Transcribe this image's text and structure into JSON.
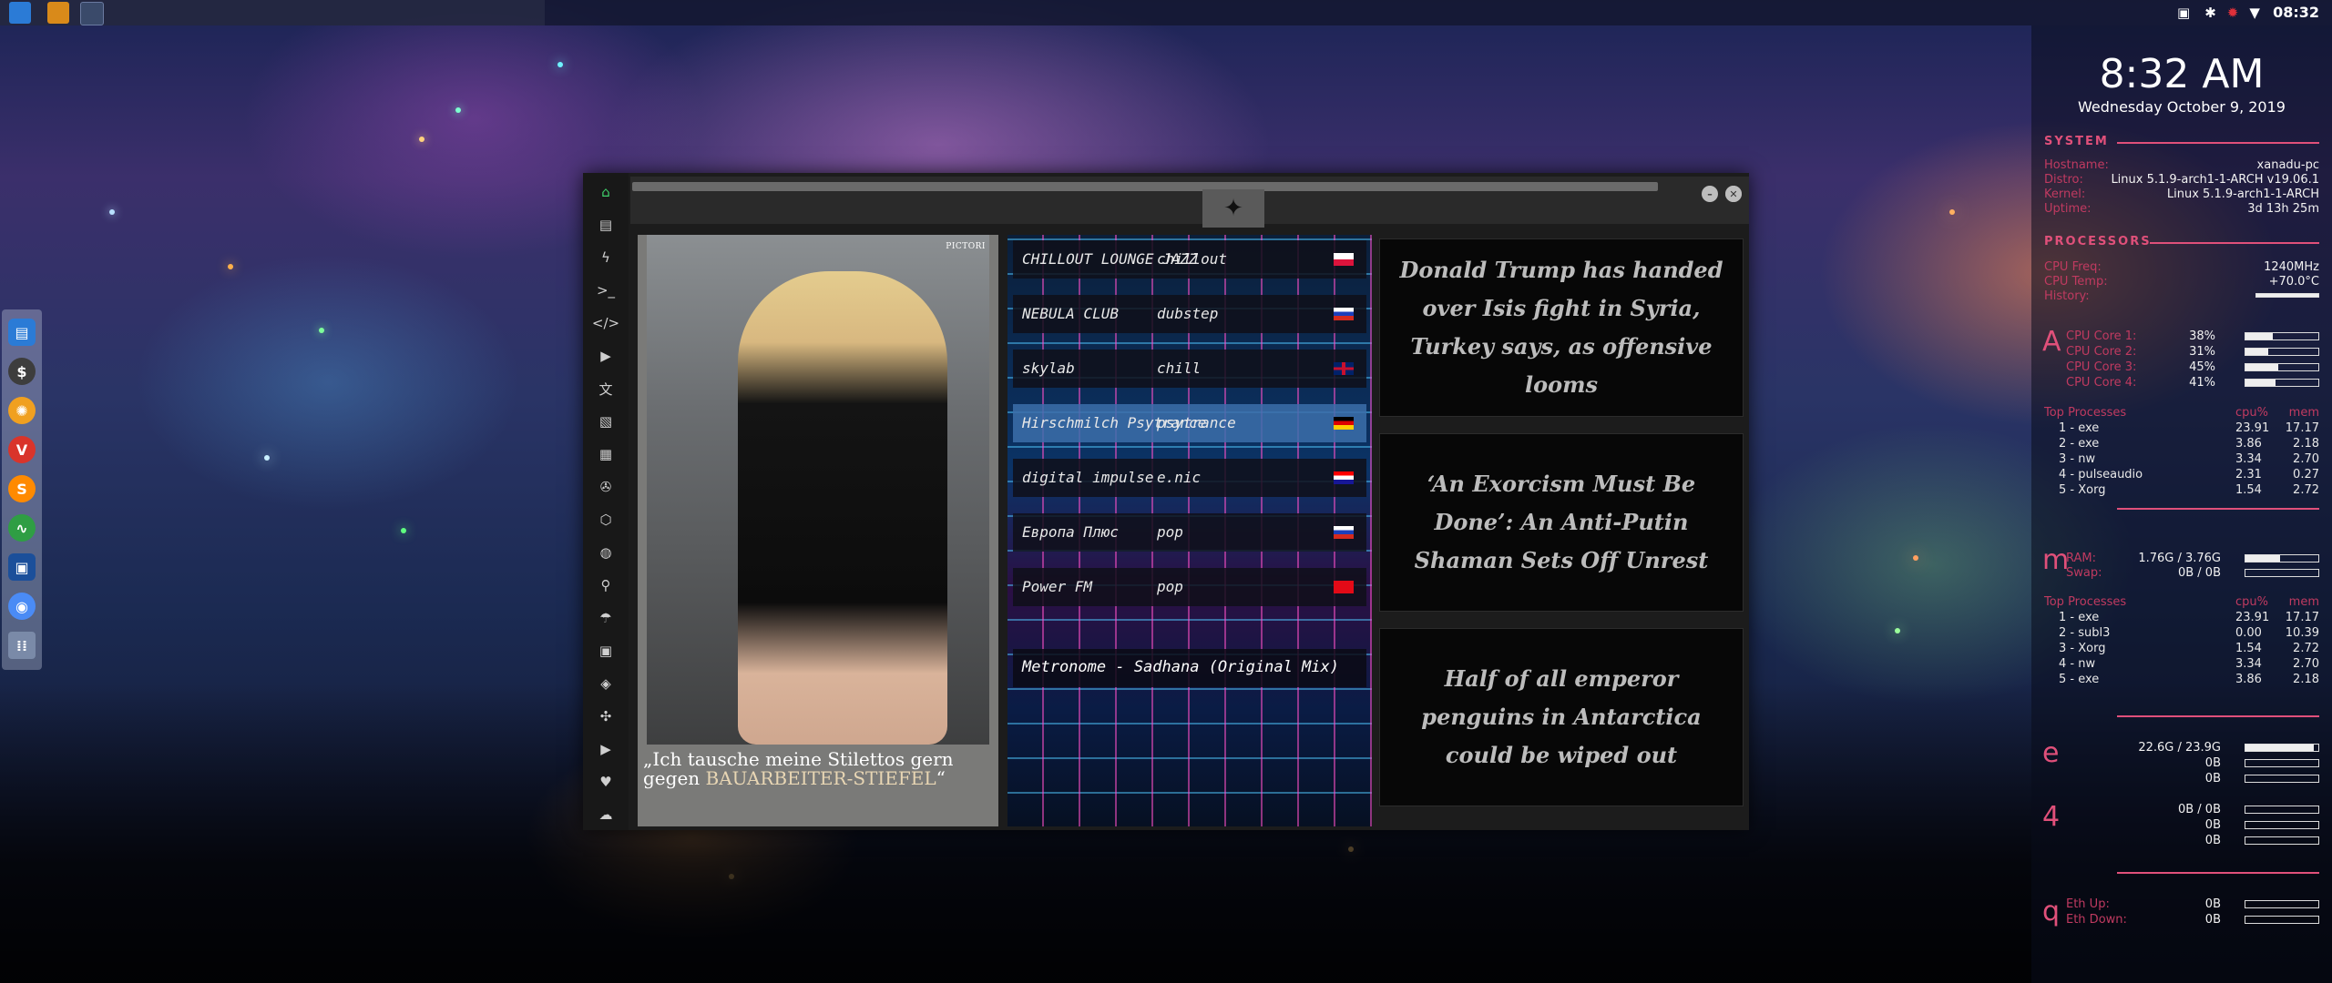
{
  "topbar": {
    "clock": "08:32",
    "tray_icons": [
      "image-icon",
      "bluetooth-icon",
      "bug-icon",
      "wifi-icon"
    ]
  },
  "dock": {
    "apps": [
      {
        "icon": "files-icon",
        "color": "#2b7bd6"
      },
      {
        "icon": "terminal-icon",
        "color": "#3d3d3d"
      },
      {
        "icon": "gear-app-icon",
        "color": "#f0a020"
      },
      {
        "icon": "vivaldi-icon",
        "color": "#d9342b"
      },
      {
        "icon": "sublime-icon",
        "color": "#ff8a00"
      },
      {
        "icon": "system-monitor-icon",
        "color": "#2f9e44"
      },
      {
        "icon": "virtualbox-icon",
        "color": "#1b4f9a"
      },
      {
        "icon": "chrome-icon",
        "color": "#4a8bf5"
      },
      {
        "icon": "app-grid-icon",
        "color": "#7a8aa8"
      }
    ]
  },
  "app": {
    "sidebar_icons": [
      "home-icon",
      "document-icon",
      "bolt-icon",
      "terminal-icon",
      "code-icon",
      "play-icon",
      "translate-icon",
      "image-icon",
      "gallery-icon",
      "aperture-icon",
      "hexagon-icon",
      "globe-icon",
      "search-icon",
      "umbrella-icon",
      "contacts-icon",
      "dev-icon",
      "expand-icon",
      "youtube-icon",
      "heart-icon",
      "cloud-icon"
    ],
    "title_emblem": "rebel-alliance-icon",
    "magazine": {
      "header": "PICTORI",
      "quote_line1": "„Ich tausche meine Stilettos gern",
      "quote_prefix": "gegen ",
      "quote_accent": "BAUARBEITER-STIEFEL",
      "quote_suffix": "“"
    },
    "stations": [
      {
        "name": "CHILLOUT LOUNGE JAZZ",
        "genre": "chillout",
        "flag": "poland",
        "active": false
      },
      {
        "name": "NEBULA CLUB",
        "genre": "dubstep",
        "flag": "russia",
        "active": false
      },
      {
        "name": "skylab",
        "genre": "chill",
        "flag": "uk",
        "active": false
      },
      {
        "name": "Hirschmilch Psytrance",
        "genre": "psytrance",
        "flag": "germany",
        "active": true
      },
      {
        "name": "digital impulse",
        "genre": "e.nic",
        "flag": "croatia",
        "active": false
      },
      {
        "name": "Европа Плюс",
        "genre": "pop",
        "flag": "russia",
        "active": false
      },
      {
        "name": "Power FM",
        "genre": "pop",
        "flag": "turkey",
        "active": false
      }
    ],
    "now_playing": "Metronome - Sadhana (Original Mix)",
    "news": [
      "Donald Trump has handed over Isis fight in Syria, Turkey says, as offensive looms",
      "‘An Exorcism Must Be Done’: An Anti-Putin Shaman Sets Off Unrest",
      "Half of all emperor penguins in Antarctica could be wiped out"
    ]
  },
  "conky": {
    "time": "8:32 AM",
    "date": "Wednesday October  9, 2019",
    "system": {
      "title": "SYSTEM",
      "rows": [
        {
          "k": "Hostname:",
          "v": "xanadu-pc"
        },
        {
          "k": "Distro:",
          "v": "Linux 5.1.9-arch1-1-ARCH v19.06.1"
        },
        {
          "k": "Kernel:",
          "v": "Linux 5.1.9-arch1-1-ARCH"
        },
        {
          "k": "Uptime:",
          "v": "3d 13h 25m"
        }
      ]
    },
    "processors": {
      "title": "PROCESSORS",
      "freq_label": "CPU Freq:",
      "freq": "1240MHz",
      "temp_label": "CPU Temp:",
      "temp": "+70.0°C",
      "history_label": "History:",
      "letter": "A",
      "cores": [
        {
          "k": "CPU Core 1:",
          "v": "38%",
          "level": 0.38
        },
        {
          "k": "CPU Core 2:",
          "v": "31%",
          "level": 0.31
        },
        {
          "k": "CPU Core 3:",
          "v": "45%",
          "level": 0.45
        },
        {
          "k": "CPU Core 4:",
          "v": "41%",
          "level": 0.41
        }
      ],
      "top_title": "Top Processes",
      "col_cpu": "cpu%",
      "col_mem": "mem",
      "procs": [
        {
          "n": "1 - exe",
          "c": "23.91",
          "m": "17.17"
        },
        {
          "n": "2 - exe",
          "c": "3.86",
          "m": "2.18"
        },
        {
          "n": "3 - nw",
          "c": "3.34",
          "m": "2.70"
        },
        {
          "n": "4 - pulseaudio",
          "c": "2.31",
          "m": "0.27"
        },
        {
          "n": "5 - Xorg",
          "c": "1.54",
          "m": "2.72"
        }
      ]
    },
    "memory": {
      "letter": "m",
      "ram_label": "RAM:",
      "ram": "1.76G / 3.76G",
      "ram_level": 0.47,
      "swap_label": "Swap:",
      "swap": "0B / 0B",
      "swap_level": 0,
      "top_title": "Top Processes",
      "col_cpu": "cpu%",
      "col_mem": "mem",
      "procs": [
        {
          "n": "1 - exe",
          "c": "23.91",
          "m": "17.17"
        },
        {
          "n": "2 - subl3",
          "c": "0.00",
          "m": "10.39"
        },
        {
          "n": "3 - Xorg",
          "c": "1.54",
          "m": "2.72"
        },
        {
          "n": "4 - nw",
          "c": "3.34",
          "m": "2.70"
        },
        {
          "n": "5 - exe",
          "c": "3.86",
          "m": "2.18"
        }
      ]
    },
    "disk": {
      "letter": "e",
      "root": "22.6G / 23.9G",
      "root_level": 0.94,
      "read": "0B",
      "write": "0B"
    },
    "disk2": {
      "letter": "4",
      "usage": "0B / 0B",
      "read": "0B",
      "write": "0B"
    },
    "network": {
      "letter": "q",
      "up_label": "Eth Up:",
      "up": "0B",
      "down_label": "Eth Down:",
      "down": "0B"
    }
  }
}
